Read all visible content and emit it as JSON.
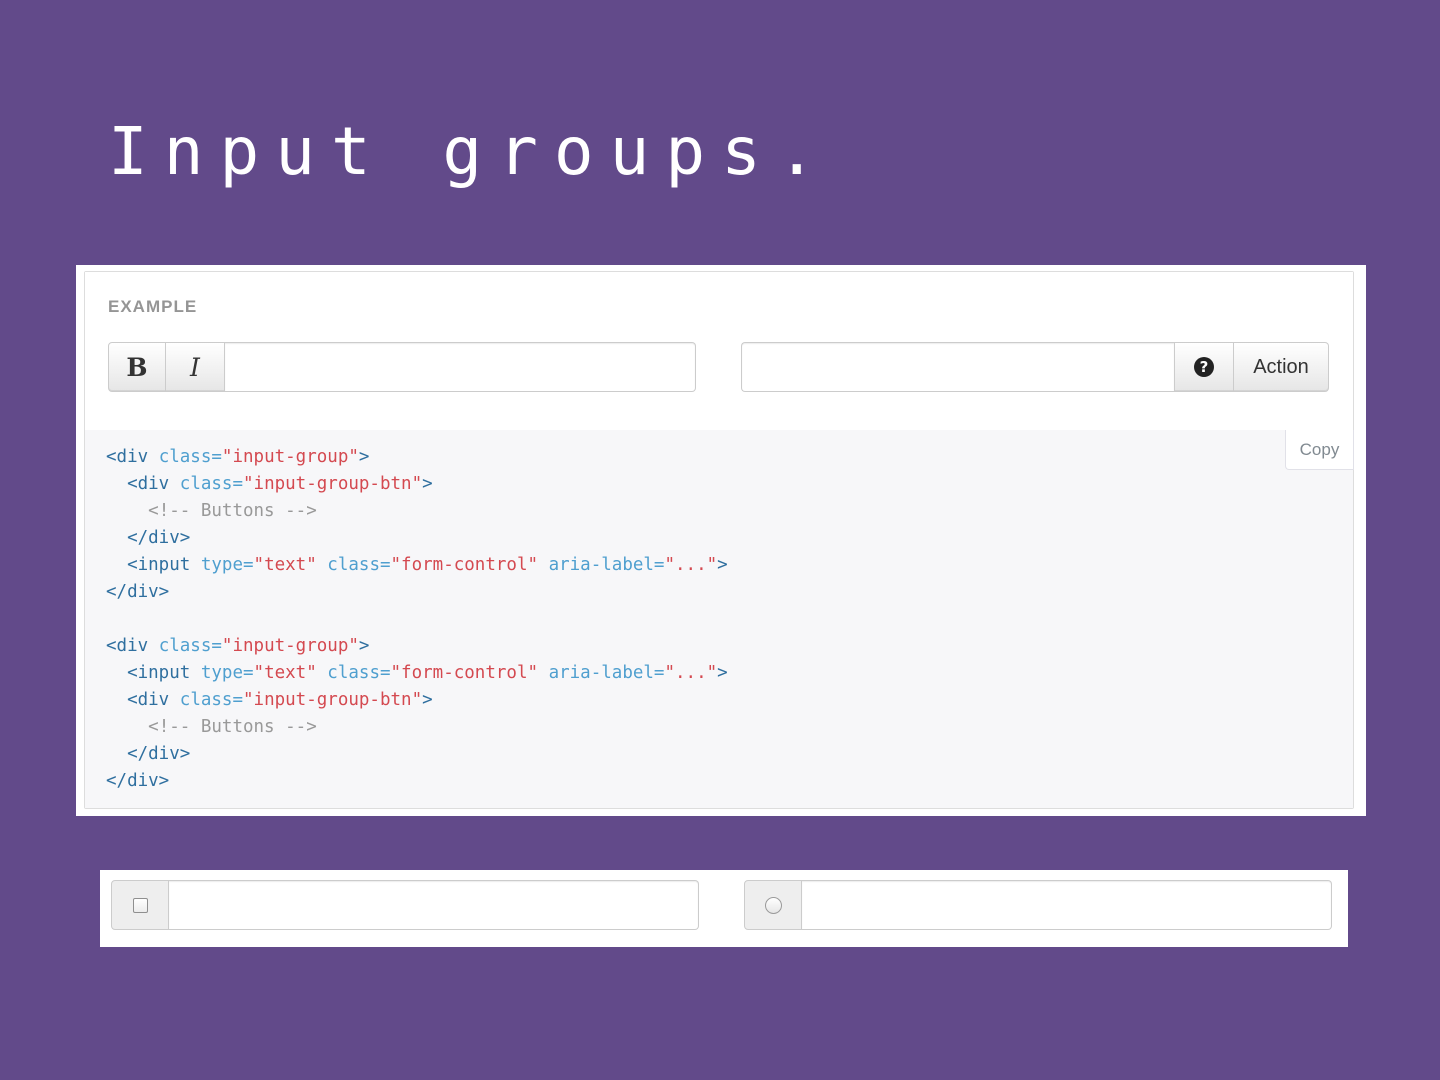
{
  "slide": {
    "title": "Input groups."
  },
  "example": {
    "label": "EXAMPLE",
    "group1": {
      "bold_label": "B",
      "italic_label": "I",
      "input_value": ""
    },
    "group2": {
      "input_value": "",
      "help_icon_glyph": "?",
      "action_label": "Action"
    }
  },
  "code": {
    "copy_label": "Copy",
    "lines": [
      [
        [
          "tag",
          "<div"
        ],
        [
          "pun",
          " "
        ],
        [
          "attr",
          "class="
        ],
        [
          "str",
          "\"input-group\""
        ],
        [
          "tag",
          ">"
        ]
      ],
      [
        [
          "pun",
          "  "
        ],
        [
          "tag",
          "<div"
        ],
        [
          "pun",
          " "
        ],
        [
          "attr",
          "class="
        ],
        [
          "str",
          "\"input-group-btn\""
        ],
        [
          "tag",
          ">"
        ]
      ],
      [
        [
          "pun",
          "    "
        ],
        [
          "cmt",
          "<!-- Buttons -->"
        ]
      ],
      [
        [
          "pun",
          "  "
        ],
        [
          "tag",
          "</div>"
        ]
      ],
      [
        [
          "pun",
          "  "
        ],
        [
          "tag",
          "<input"
        ],
        [
          "pun",
          " "
        ],
        [
          "attr",
          "type="
        ],
        [
          "str",
          "\"text\""
        ],
        [
          "pun",
          " "
        ],
        [
          "attr",
          "class="
        ],
        [
          "str",
          "\"form-control\""
        ],
        [
          "pun",
          " "
        ],
        [
          "attr",
          "aria-label="
        ],
        [
          "str",
          "\"...\""
        ],
        [
          "tag",
          ">"
        ]
      ],
      [
        [
          "tag",
          "</div>"
        ]
      ],
      [],
      [
        [
          "tag",
          "<div"
        ],
        [
          "pun",
          " "
        ],
        [
          "attr",
          "class="
        ],
        [
          "str",
          "\"input-group\""
        ],
        [
          "tag",
          ">"
        ]
      ],
      [
        [
          "pun",
          "  "
        ],
        [
          "tag",
          "<input"
        ],
        [
          "pun",
          " "
        ],
        [
          "attr",
          "type="
        ],
        [
          "str",
          "\"text\""
        ],
        [
          "pun",
          " "
        ],
        [
          "attr",
          "class="
        ],
        [
          "str",
          "\"form-control\""
        ],
        [
          "pun",
          " "
        ],
        [
          "attr",
          "aria-label="
        ],
        [
          "str",
          "\"...\""
        ],
        [
          "tag",
          ">"
        ]
      ],
      [
        [
          "pun",
          "  "
        ],
        [
          "tag",
          "<div"
        ],
        [
          "pun",
          " "
        ],
        [
          "attr",
          "class="
        ],
        [
          "str",
          "\"input-group-btn\""
        ],
        [
          "tag",
          ">"
        ]
      ],
      [
        [
          "pun",
          "    "
        ],
        [
          "cmt",
          "<!-- Buttons -->"
        ]
      ],
      [
        [
          "pun",
          "  "
        ],
        [
          "tag",
          "</div>"
        ]
      ],
      [
        [
          "tag",
          "</div>"
        ]
      ]
    ]
  },
  "bottom": {
    "checkbox_group": {
      "checked": false,
      "input_value": ""
    },
    "radio_group": {
      "selected": false,
      "input_value": ""
    }
  },
  "colors": {
    "background": "#624a8a",
    "code_tag": "#2f6f9f",
    "code_attr": "#4f9fcf",
    "code_string": "#d44950",
    "code_comment": "#999999"
  },
  "icons": {
    "help": "question-circle-icon",
    "checkbox": "checkbox-icon",
    "radio": "radio-icon"
  }
}
